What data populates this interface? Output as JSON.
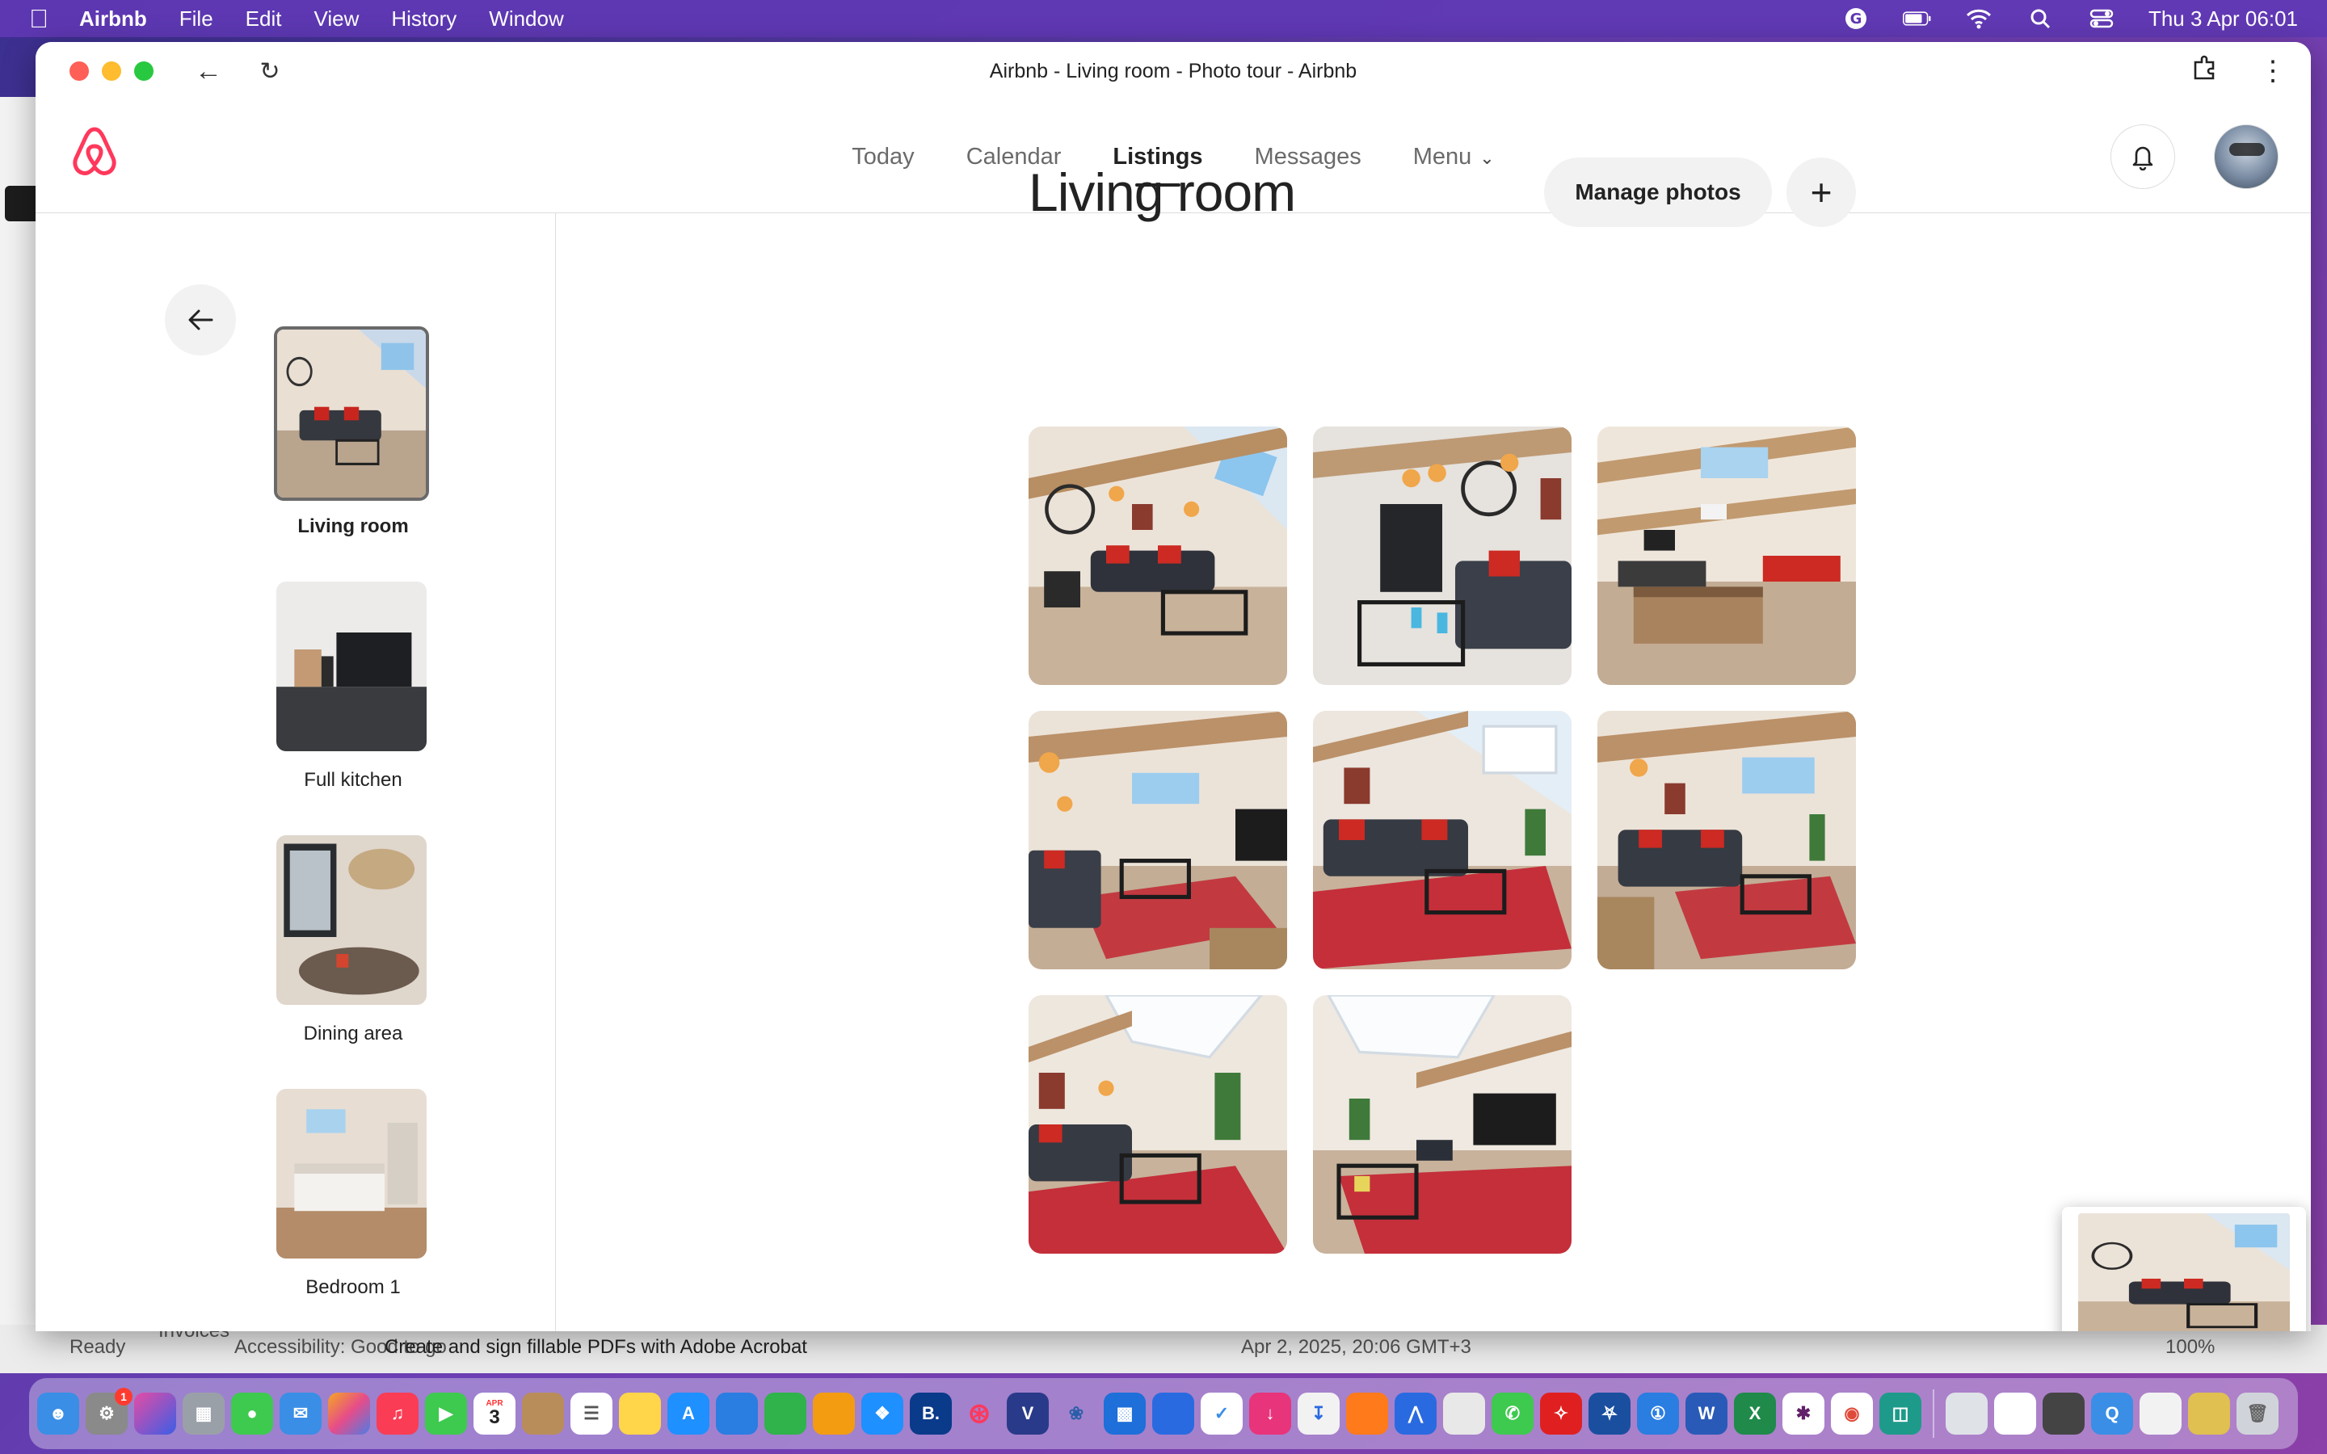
{
  "menubar": {
    "app_name": "Airbnb",
    "items": [
      "File",
      "Edit",
      "View",
      "History",
      "Window"
    ],
    "datetime": "Thu 3 Apr  06:01"
  },
  "window": {
    "title": "Airbnb - Living room - Photo tour - Airbnb"
  },
  "header": {
    "nav": [
      {
        "label": "Today",
        "active": false
      },
      {
        "label": "Calendar",
        "active": false
      },
      {
        "label": "Listings",
        "active": true
      },
      {
        "label": "Messages",
        "active": false
      },
      {
        "label": "Menu",
        "active": false
      }
    ]
  },
  "sidebar": {
    "rooms": [
      {
        "label": "Living room",
        "selected": true
      },
      {
        "label": "Full kitchen",
        "selected": false
      },
      {
        "label": "Dining area",
        "selected": false
      },
      {
        "label": "Bedroom 1",
        "selected": false
      }
    ]
  },
  "main": {
    "title": "Living room",
    "manage_label": "Manage photos",
    "add_label": "+",
    "photo_count": 8
  },
  "background_app": {
    "sidebar_item": "Invoices",
    "status_ready": "Ready",
    "status_accessibility": "Accessibility: Good to go",
    "status_hint": "Create and sign fillable PDFs with Adobe Acrobat",
    "status_date": "Apr 2, 2025, 20:06 GMT+3",
    "zoom": "100%"
  },
  "dock": {
    "calendar_month": "APR",
    "calendar_day": "3"
  },
  "colors": {
    "brand": "#FF385C",
    "text": "#222222",
    "muted": "#6A6A6A"
  }
}
